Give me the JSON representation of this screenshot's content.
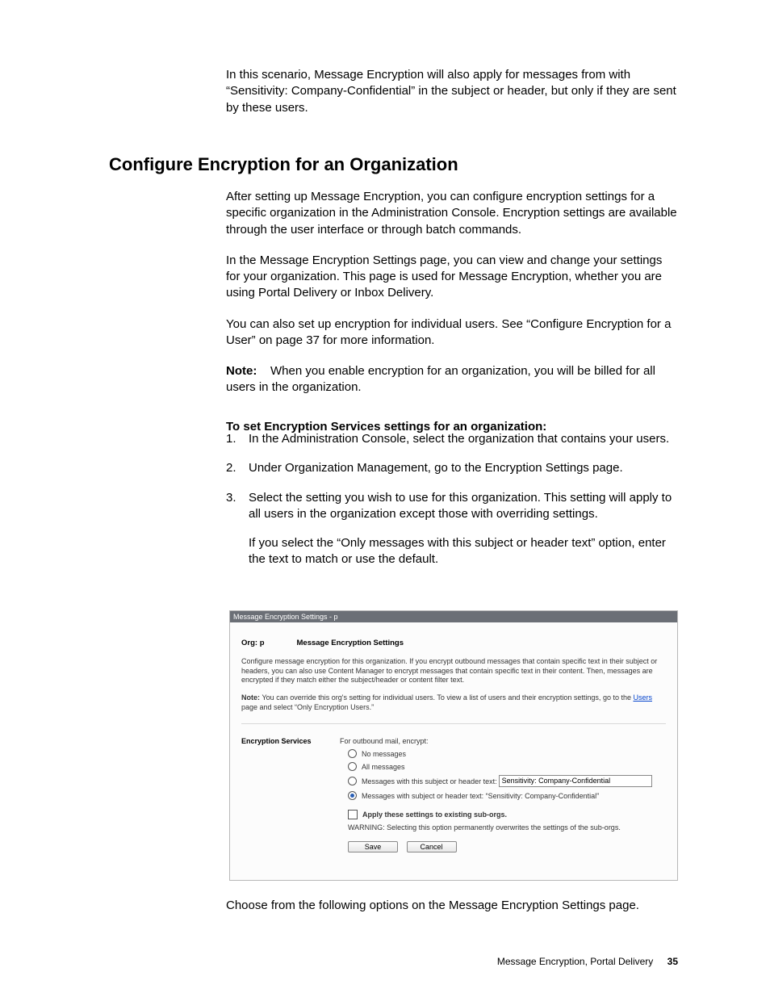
{
  "intro_paragraph": "In this scenario, Message Encryption will also apply for messages from with “Sensitivity: Company-Confidential” in the subject or header, but only if they are sent by these users.",
  "heading": "Configure Encryption for an Organization",
  "paragraphs": {
    "p1": "After setting up Message Encryption, you can configure encryption settings for a specific organization in the Administration Console. Encryption settings are available through the user interface or through batch commands.",
    "p2": "In the Message Encryption Settings page, you can view and change your settings for your organization. This page is used for Message Encryption, whether you are using Portal Delivery or Inbox Delivery.",
    "p3": "You can also set up encryption for individual users. See “Configure Encryption for a User” on page 37 for more information.",
    "note_label": "Note:",
    "note_body": "When you enable encryption for an organization, you will be billed for all users in the organization.",
    "procedure_title": "To set Encryption Services settings for an organization:"
  },
  "steps": {
    "s1_num": "1.",
    "s1": "In the Administration Console, select the organization that contains your users.",
    "s2_num": "2.",
    "s2": "Under Organization Management, go to the Encryption Settings page.",
    "s3_num": "3.",
    "s3": "Select the setting you wish to use for this organization. This setting will apply to all users in the organization except those with overriding settings.",
    "s3_sub": "If you select the “Only messages with this subject or header text” option, enter the text to match or use the default."
  },
  "screenshot": {
    "titlebar": "Message Encryption Settings - p",
    "org_label": "Org: p",
    "panel_title": "Message Encryption Settings",
    "desc": "Configure message encryption for this organization. If you encrypt outbound messages that contain specific text in their subject or headers, you can also use Content Manager to encrypt messages that contain specific text in their content. Then, messages are encrypted if they match either the subject/header or content filter text.",
    "note_prefix": "Note: ",
    "note_before_link": "You can override this org's setting for individual users. To view a list of users and their encryption settings, go to the ",
    "note_link": "Users",
    "note_after_link": " page and select “Only Encryption Users.”",
    "section_label": "Encryption Services",
    "outbound_label": "For outbound mail, encrypt:",
    "opt_none": "No messages",
    "opt_all": "All messages",
    "opt_custom_prefix": "Messages with this subject or header text:",
    "opt_custom_value": "Sensitivity: Company-Confidential",
    "opt_default": "Messages with subject or header text: “Sensitivity: Company-Confidential”",
    "apply_label": "Apply these settings to existing sub-orgs.",
    "apply_warning": "WARNING: Selecting this option permanently overwrites the settings of the sub-orgs.",
    "btn_save": "Save",
    "btn_cancel": "Cancel"
  },
  "after_shot": "Choose from the following options on the Message Encryption Settings page.",
  "footer": {
    "title": "Message Encryption, Portal Delivery",
    "page": "35"
  }
}
